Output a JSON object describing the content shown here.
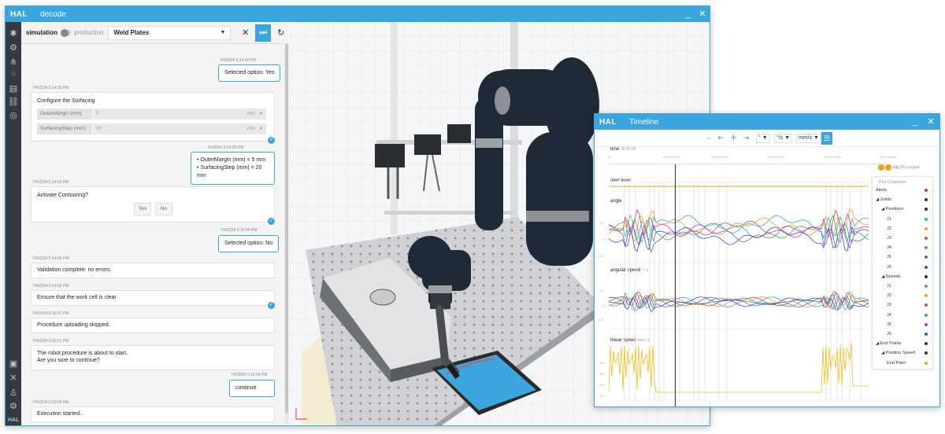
{
  "main_window": {
    "logo": "HAL",
    "title": "decode",
    "minimize_label": "_",
    "close_label": "✕"
  },
  "left_bar": {
    "icons": [
      "settings-icon",
      "robot-arm-icon",
      "tree-icon",
      "scatter-icon",
      "document-icon",
      "link-icon",
      "check-circle-icon"
    ],
    "bottom_icons": [
      "save-icon",
      "close-icon",
      "user-icon",
      "gear-icon"
    ],
    "bottom_logo": "HAL"
  },
  "toolbar": {
    "simulation_label": "simulation",
    "production_label": "production",
    "procedure_value": "Weld Plates",
    "caret": "▼",
    "close_glyph": "✕",
    "step_glyph": "⏭",
    "reset_glyph": "↻"
  },
  "chat": {
    "messages": [
      {
        "ts": "7/4/2024 5:14:49 PM",
        "user": true,
        "text": "Selected option: Yes"
      },
      {
        "ts": "7/4/2024 5:14:50 PM",
        "title": "Configure the Surfacing",
        "fields": [
          {
            "label": "OuterMargin (mm)",
            "value": "5",
            "unit": "mm"
          },
          {
            "label": "SurfacingStep (mm)",
            "value": "20",
            "unit": "mm"
          }
        ]
      },
      {
        "ts": "7/4/2024 5:14:53 PM",
        "user": true,
        "lines": [
          "• OuterMargin (mm) = 5 mm",
          "• SurfacingStep (mm) = 20 mm"
        ]
      },
      {
        "ts": "7/4/2024 5:14:53 PM",
        "title": "Activate Contouring?",
        "buttons": [
          "Yes",
          "No"
        ]
      },
      {
        "ts": "7/4/2024 5:14:54 PM",
        "user": true,
        "text": "Selected option: No"
      },
      {
        "ts": "7/4/2024 5:14:58 PM",
        "text": "Validation complete: no errors."
      },
      {
        "ts": "7/4/2024 5:14:59 PM",
        "text": "Ensure that the work cell is clear"
      },
      {
        "ts": "7/4/2024 5:15:01 PM",
        "text": "Procedure uploading skipped."
      },
      {
        "ts": "7/4/2024 5:15:01 PM",
        "lines": [
          "The robot procedure is about to start.",
          "Are you sure to continue?"
        ]
      },
      {
        "ts": "7/4/2024 5:15:04 PM",
        "user": true,
        "text": "continue"
      },
      {
        "ts": "7/4/2024 5:15:04 PM",
        "text": "Execution started..."
      }
    ],
    "unit_caret": "▼",
    "check_glyph": "✓"
  },
  "timeline": {
    "logo": "HAL",
    "title": "Timeline",
    "minimize_label": "_",
    "close_label": "✕",
    "unit_selects": [
      "° ▼",
      "°/s ▼",
      "mm/s ▼"
    ],
    "menu_glyph": "☰",
    "time_label": "time",
    "time_unit": "00:00:00",
    "ticks": [
      "0",
      "00:00:02.00",
      "00:00:06.00",
      "00:01:00.00",
      "00:01:30.00",
      "00:01:56.00"
    ],
    "procedure_badge": "HAL/Procedure",
    "rows": [
      {
        "label": "alert level",
        "unit": ""
      },
      {
        "label": "angle",
        "unit": ""
      },
      {
        "label": "angular speed",
        "unit": "° / s"
      },
      {
        "label": "linear speed",
        "unit": "mm / s"
      }
    ],
    "plot_channels": {
      "header": "Plot Channels",
      "items": [
        {
          "label": "Alerts",
          "indent": 0,
          "color": "#e0332f"
        },
        {
          "label": "◢ Joints",
          "indent": 0,
          "color": "#333333"
        },
        {
          "label": "◢ Positions",
          "indent": 1,
          "color": "#333333"
        },
        {
          "label": "J1",
          "indent": 2,
          "color": "#2ab0e0"
        },
        {
          "label": "J2",
          "indent": 2,
          "color": "#f0a020"
        },
        {
          "label": "J3",
          "indent": 2,
          "color": "#e03a8a"
        },
        {
          "label": "J4",
          "indent": 2,
          "color": "#40b040"
        },
        {
          "label": "J5",
          "indent": 2,
          "color": "#8a50c8"
        },
        {
          "label": "J6",
          "indent": 2,
          "color": "#3058c0"
        },
        {
          "label": "◢ Speeds",
          "indent": 1,
          "color": "#333333"
        },
        {
          "label": "J1",
          "indent": 2,
          "color": "#2ab0e0"
        },
        {
          "label": "J2",
          "indent": 2,
          "color": "#f0a020"
        },
        {
          "label": "J3",
          "indent": 2,
          "color": "#e03a8a"
        },
        {
          "label": "J4",
          "indent": 2,
          "color": "#40b040"
        },
        {
          "label": "J5",
          "indent": 2,
          "color": "#8a50c8"
        },
        {
          "label": "J6",
          "indent": 2,
          "color": "#3058c0"
        },
        {
          "label": "◢ End Points",
          "indent": 0,
          "color": "#333333"
        },
        {
          "label": "◢ Position Speed",
          "indent": 1,
          "color": "#333333"
        },
        {
          "label": "End Point",
          "indent": 2,
          "color": "#f0a020"
        }
      ]
    },
    "y_ticks": {
      "angle": [
        "2.0",
        "0",
        "-2.0"
      ],
      "speed": [
        "2.0",
        "0",
        "-2.0"
      ],
      "linear": [
        "400",
        "300",
        "200",
        "100"
      ]
    }
  },
  "colors": {
    "accent": "#3aa6dd",
    "robot": "#1f2a36",
    "plate": "#3aa6dd",
    "sidebar": "#333a40"
  }
}
